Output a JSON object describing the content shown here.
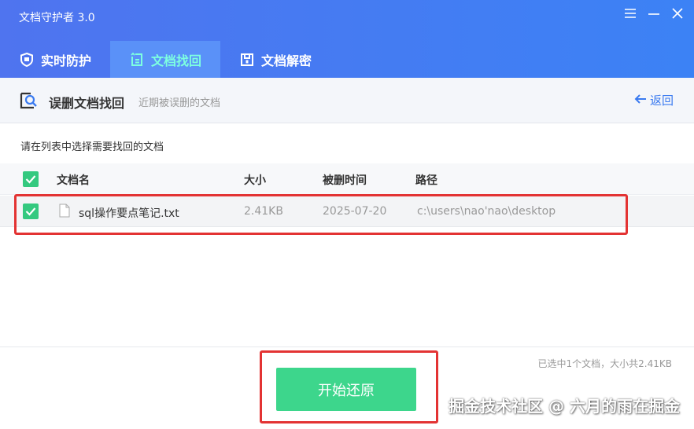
{
  "app": {
    "title": "文档守护者 3.0"
  },
  "tabs": [
    {
      "label": "实时防护",
      "icon": "shield-icon"
    },
    {
      "label": "文档找回",
      "icon": "file-restore-icon",
      "active": true
    },
    {
      "label": "文档解密",
      "icon": "lock-file-icon"
    }
  ],
  "subheader": {
    "title": "误删文档找回",
    "description": "近期被误删的文档",
    "back_label": "返回"
  },
  "instruction": "请在列表中选择需要找回的文档",
  "table": {
    "columns": [
      "文档名",
      "大小",
      "被删时间",
      "路径"
    ],
    "rows": [
      {
        "checked": true,
        "name": "sql操作要点笔记.txt",
        "size": "2.41KB",
        "deleted_time": "2025-07-20",
        "path": "c:\\users\\nao'nao\\desktop"
      }
    ]
  },
  "summary": "已选中1个文档，大小共2.41KB",
  "restore_button": "开始还原",
  "watermark": "掘金技术社区 @ 六月的雨在掘金",
  "colors": {
    "header": "#4f74ef",
    "active_tab_text": "#7dffe0",
    "checkbox": "#34c97f",
    "button": "#3dd68c",
    "highlight": "#e33333"
  }
}
